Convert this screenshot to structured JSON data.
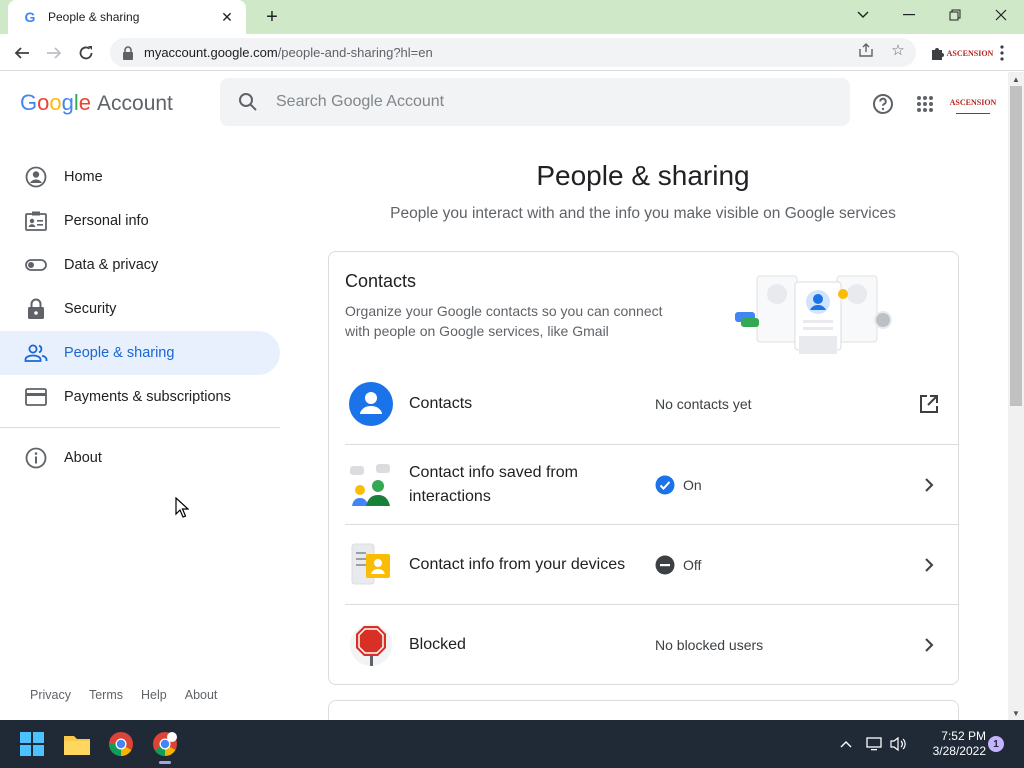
{
  "browser": {
    "tab_title": "People & sharing",
    "tab_favicon": "G",
    "url_host": "myaccount.google.com",
    "url_path": "/people-and-sharing?hl=en",
    "profile_logo_text": "ASCENSION"
  },
  "header": {
    "logo_letters": [
      "G",
      "o",
      "o",
      "g",
      "l",
      "e"
    ],
    "logo_account": "Account",
    "search_placeholder": "Search Google Account",
    "avatar_text": "ASCENSION"
  },
  "sidebar": {
    "items": [
      {
        "label": "Home",
        "icon": "account-circle-icon"
      },
      {
        "label": "Personal info",
        "icon": "id-card-icon"
      },
      {
        "label": "Data & privacy",
        "icon": "toggle-icon"
      },
      {
        "label": "Security",
        "icon": "lock-icon"
      },
      {
        "label": "People & sharing",
        "icon": "people-icon",
        "active": true
      },
      {
        "label": "Payments & subscriptions",
        "icon": "credit-card-icon"
      }
    ],
    "about": {
      "label": "About",
      "icon": "info-icon"
    },
    "footer": [
      "Privacy",
      "Terms",
      "Help",
      "About"
    ]
  },
  "main": {
    "title": "People & sharing",
    "subtitle": "People you interact with and the info you make visible on Google services",
    "card": {
      "title": "Contacts",
      "description": "Organize your Google contacts so you can connect with people on Google services, like Gmail",
      "rows": [
        {
          "label": "Contacts",
          "status": "No contacts yet",
          "status_icon": "",
          "action_icon": "open-in-new-icon"
        },
        {
          "label": "Contact info saved from interactions",
          "status": "On",
          "status_icon": "check-circle-icon",
          "action_icon": "chevron-right-icon"
        },
        {
          "label": "Contact info from your devices",
          "status": "Off",
          "status_icon": "minus-circle-icon",
          "action_icon": "chevron-right-icon"
        },
        {
          "label": "Blocked",
          "status": "No blocked users",
          "status_icon": "",
          "action_icon": "chevron-right-icon"
        }
      ]
    }
  },
  "taskbar": {
    "time": "7:52 PM",
    "date": "3/28/2022",
    "notification_count": "1"
  },
  "colors": {
    "accent": "#1a73e8",
    "active_bg": "#e8f0fe",
    "titlebar": "#cfe8c7",
    "taskbar": "#1f2a36"
  }
}
